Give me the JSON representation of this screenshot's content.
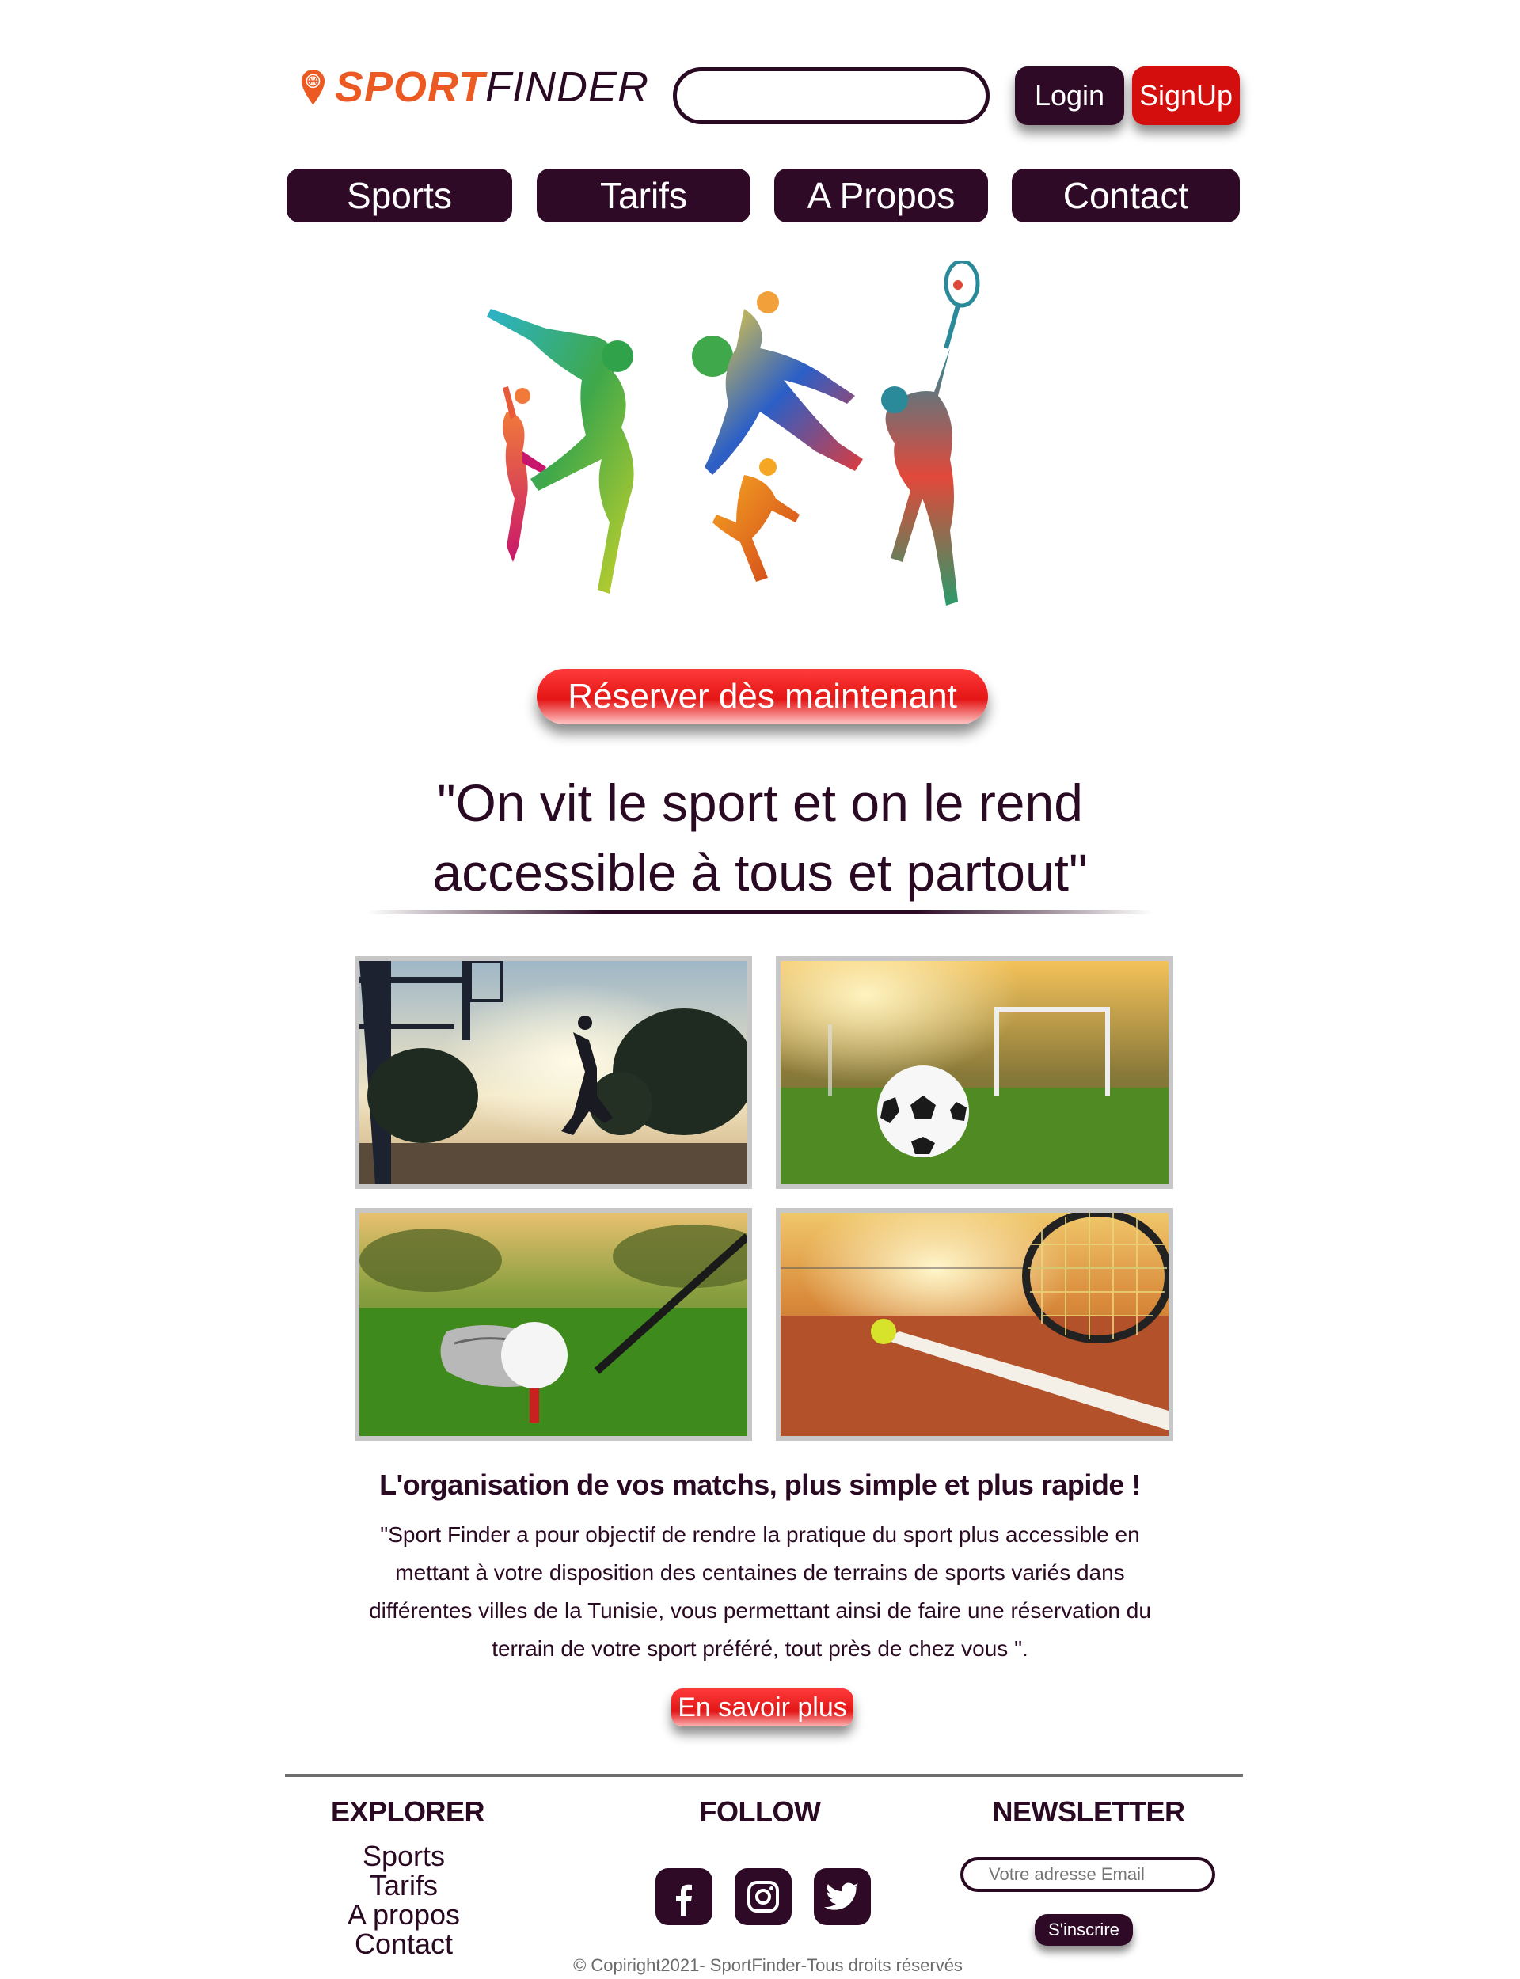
{
  "header": {
    "brand_part1": "SPORT",
    "brand_part2": "FINDER",
    "search_placeholder": "",
    "login_label": "Login",
    "signup_label": "SignUp"
  },
  "nav": {
    "items": [
      {
        "label": "Sports"
      },
      {
        "label": "Tarifs"
      },
      {
        "label": "A Propos"
      },
      {
        "label": "Contact"
      }
    ]
  },
  "hero": {
    "cta_label": "Réserver dès maintenant",
    "quote_line1": "\"On vit le sport et on le rend",
    "quote_line2": "accessible à tous et partout\""
  },
  "gallery": {
    "photos": [
      {
        "icon": "basketball-photo"
      },
      {
        "icon": "football-photo"
      },
      {
        "icon": "golf-photo"
      },
      {
        "icon": "tennis-photo"
      }
    ]
  },
  "about": {
    "headline": "L'organisation de vos matchs, plus simple et plus rapide !",
    "lines": [
      "\"Sport Finder a pour objectif de rendre la pratique du sport plus accessible en",
      "mettant à votre disposition des centaines de terrains de sports variés dans",
      "différentes villes de la Tunisie, vous permettant ainsi de faire une réservation du",
      "terrain de votre sport préféré,  tout près de chez vous \"."
    ],
    "learn_more_label": "En savoir plus"
  },
  "footer": {
    "explorer_title": "EXPLORER",
    "explorer_links": [
      "Sports",
      "Tarifs",
      "A propos",
      "Contact"
    ],
    "follow_title": "FOLLOW",
    "social_icons": [
      "facebook-icon",
      "instagram-icon",
      "twitter-icon"
    ],
    "newsletter_title": "NEWSLETTER",
    "newsletter_placeholder": "Votre adresse Email",
    "subscribe_label": "S'inscrire",
    "copyright": "© Copiright2021- SportFinder-Tous droits réservés"
  },
  "colors": {
    "brand_orange": "#ec5a24",
    "primary_dark": "#2e0a27",
    "accent_red": "#d40d0d"
  }
}
